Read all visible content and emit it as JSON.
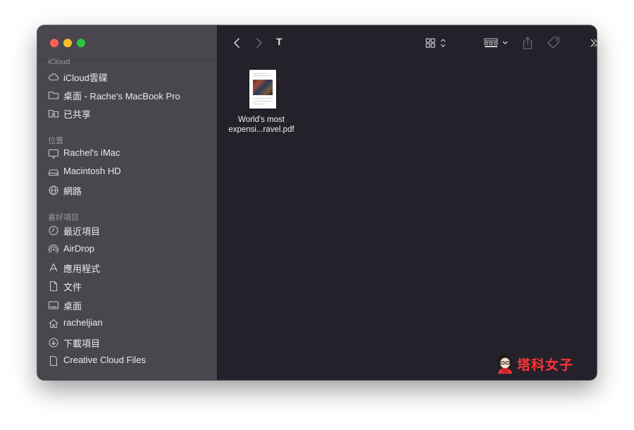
{
  "window": {
    "current_folder": "T"
  },
  "sidebar": {
    "sections": [
      {
        "label": "iCloud",
        "items": [
          {
            "label": "iCloud雲碟",
            "icon": "cloud-icon"
          },
          {
            "label": "桌面 - Rache's MacBook Pro",
            "icon": "folder-icon"
          },
          {
            "label": "已共享",
            "icon": "shared-folder-icon"
          }
        ]
      },
      {
        "label": "位置",
        "items": [
          {
            "label": "Rachel's iMac",
            "icon": "imac-icon"
          },
          {
            "label": "Macintosh HD",
            "icon": "hard-drive-icon"
          },
          {
            "label": "網路",
            "icon": "globe-icon"
          }
        ]
      },
      {
        "label": "喜好項目",
        "items": [
          {
            "label": "最近項目",
            "icon": "clock-icon"
          },
          {
            "label": "AirDrop",
            "icon": "airdrop-icon"
          },
          {
            "label": "應用程式",
            "icon": "applications-icon"
          },
          {
            "label": "文件",
            "icon": "document-icon"
          },
          {
            "label": "桌面",
            "icon": "desktop-icon"
          },
          {
            "label": "racheljian",
            "icon": "home-icon"
          },
          {
            "label": "下載項目",
            "icon": "download-icon"
          },
          {
            "label": "Creative Cloud Files",
            "icon": "file-icon"
          }
        ]
      }
    ]
  },
  "toolbar": {
    "icons": [
      "back-icon",
      "forward-icon",
      "icon-view-icon",
      "group-by-icon",
      "share-icon",
      "tag-icon",
      "more-icon",
      "search-icon"
    ]
  },
  "files": [
    {
      "name_line1": "World's most",
      "name_line2": "expensi...ravel.pdf",
      "type": "pdf"
    }
  ],
  "watermark": {
    "text": "塔科女子"
  },
  "colors": {
    "sidebar_bg": "#4a464e",
    "content_bg": "#25212a",
    "close": "#fe5f57",
    "minimize": "#febc2e",
    "zoom": "#28c840",
    "watermark": "#ff3438"
  }
}
